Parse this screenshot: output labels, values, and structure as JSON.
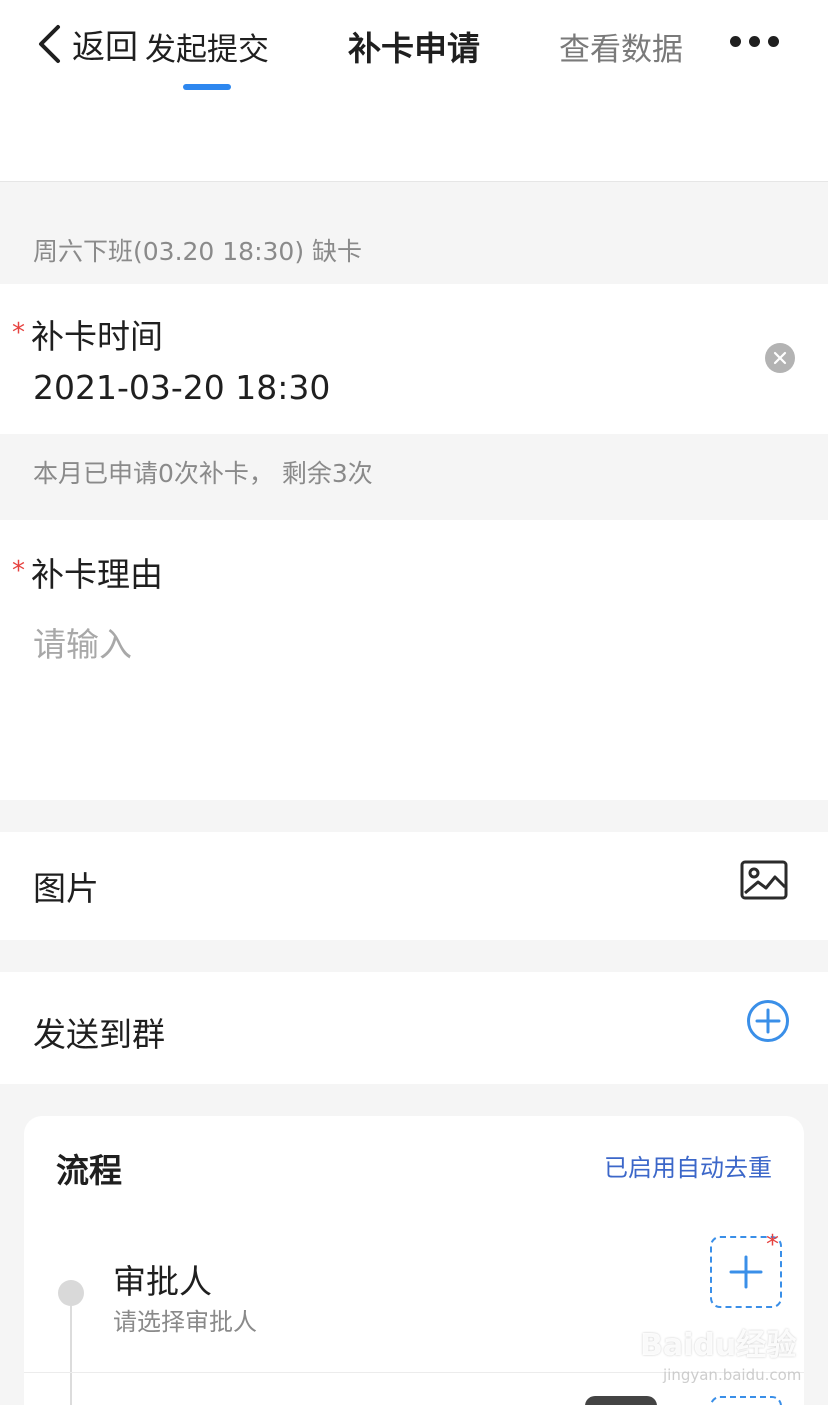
{
  "nav": {
    "back_label": "返回",
    "title": "补卡申请"
  },
  "tabs": [
    {
      "label": "发起提交",
      "active": true
    },
    {
      "label": "查看数据",
      "active": false
    }
  ],
  "missing_notice": "周六下班(03.20 18:30) 缺卡",
  "reissue_time": {
    "required_mark": "*",
    "label": "补卡时间",
    "value": "2021-03-20 18:30"
  },
  "quota_hint": "本月已申请0次补卡， 剩余3次",
  "reason": {
    "required_mark": "*",
    "label": "补卡理由",
    "placeholder": "请输入"
  },
  "picture": {
    "label": "图片",
    "icon": "image-icon"
  },
  "send_group": {
    "label": "发送到群",
    "icon": "plus-circle-icon"
  },
  "process": {
    "title": "流程",
    "dedupe_status": "已启用自动去重",
    "approver": {
      "label": "审批人",
      "hint": "请选择审批人",
      "required_mark": "*"
    }
  },
  "watermark": {
    "brand": "Baidu经验",
    "url": "jingyan.baidu.com"
  },
  "colors": {
    "accent": "#2d87ef",
    "required": "#e64340",
    "link": "#3c67c9"
  }
}
